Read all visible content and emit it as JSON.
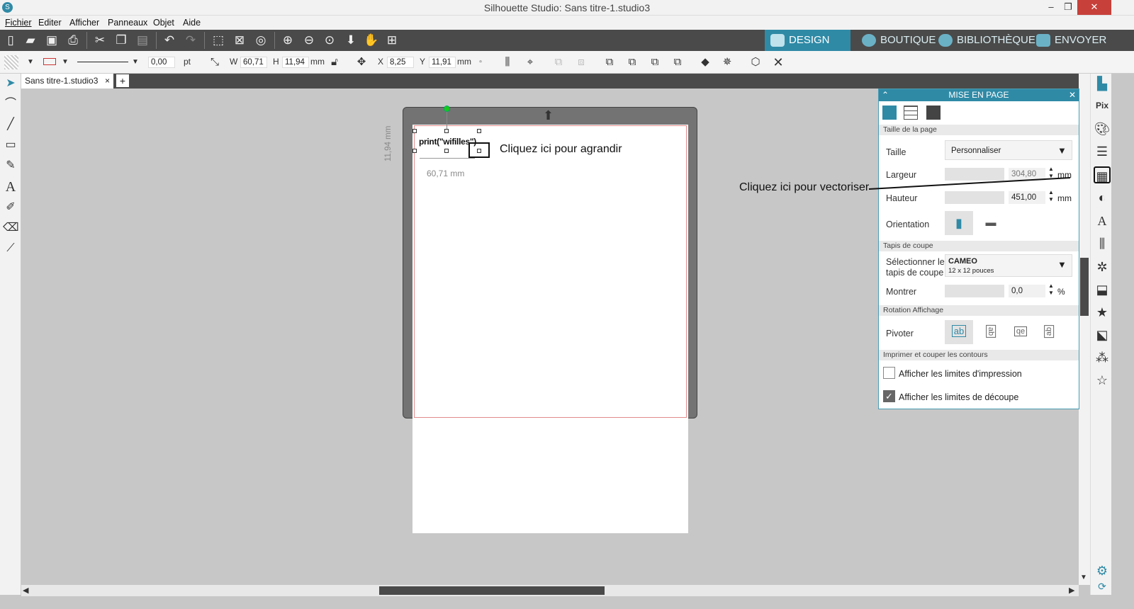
{
  "window": {
    "title": "Silhouette Studio: Sans titre-1.studio3",
    "minimize": "–",
    "restore": "❐",
    "close": "✕"
  },
  "menu": [
    "Fichier",
    "Editer",
    "Afficher",
    "Panneaux",
    "Objet",
    "Aide"
  ],
  "nav_tabs": {
    "design": "DESIGN",
    "boutique": "BOUTIQUE",
    "bibliotheque": "BIBLIOTHÈQUE",
    "envoyer": "ENVOYER"
  },
  "props": {
    "line_width": "0,00",
    "line_unit": "pt",
    "w_label": "W",
    "w_value": "60,71",
    "h_label": "H",
    "h_value": "11,94",
    "size_unit": "mm",
    "x_label": "X",
    "x_value": "8,25",
    "y_label": "Y",
    "y_value": "11,91",
    "pos_unit": "mm"
  },
  "doc_tab": {
    "label": "Sans titre-1.studio3",
    "close": "×",
    "add": "+"
  },
  "canvas": {
    "text_object": "print(\"wifilles\")",
    "width_dim": "60,71 mm",
    "height_dim": "11,94 mm",
    "annotation_enlarge": "Cliquez ici pour agrandir",
    "annotation_vectorize": "Cliquez ici pour vectoriser"
  },
  "panel": {
    "title": "MISE EN PAGE",
    "section_page_size": "Taille de la page",
    "size_label": "Taille",
    "size_value": "Personnaliser",
    "width_label": "Largeur",
    "width_value": "304,80",
    "height_label": "Hauteur",
    "height_value": "451,00",
    "unit": "mm",
    "orientation_label": "Orientation",
    "section_mat": "Tapis de coupe",
    "mat_label_1": "Sélectionner le",
    "mat_label_2": "tapis de coupe",
    "mat_value": "CAMEO",
    "mat_subvalue": "12 x 12 pouces",
    "show_label": "Montrer",
    "show_value": "0,0",
    "show_unit": "%",
    "section_rotation": "Rotation Affichage",
    "rotate_label": "Pivoter",
    "rotate_options": [
      "ab",
      "ab",
      "qe",
      "ab"
    ],
    "section_print": "Imprimer et couper les contours",
    "print_limits_label": "Afficher les limites d'impression",
    "print_limits_checked": false,
    "cut_limits_label": "Afficher les limites de découpe",
    "cut_limits_checked": true
  },
  "colors": {
    "accent": "#2f8aa6",
    "toolbar_dark": "#4a4a4a",
    "canvas_bg": "#c7c7c7"
  }
}
